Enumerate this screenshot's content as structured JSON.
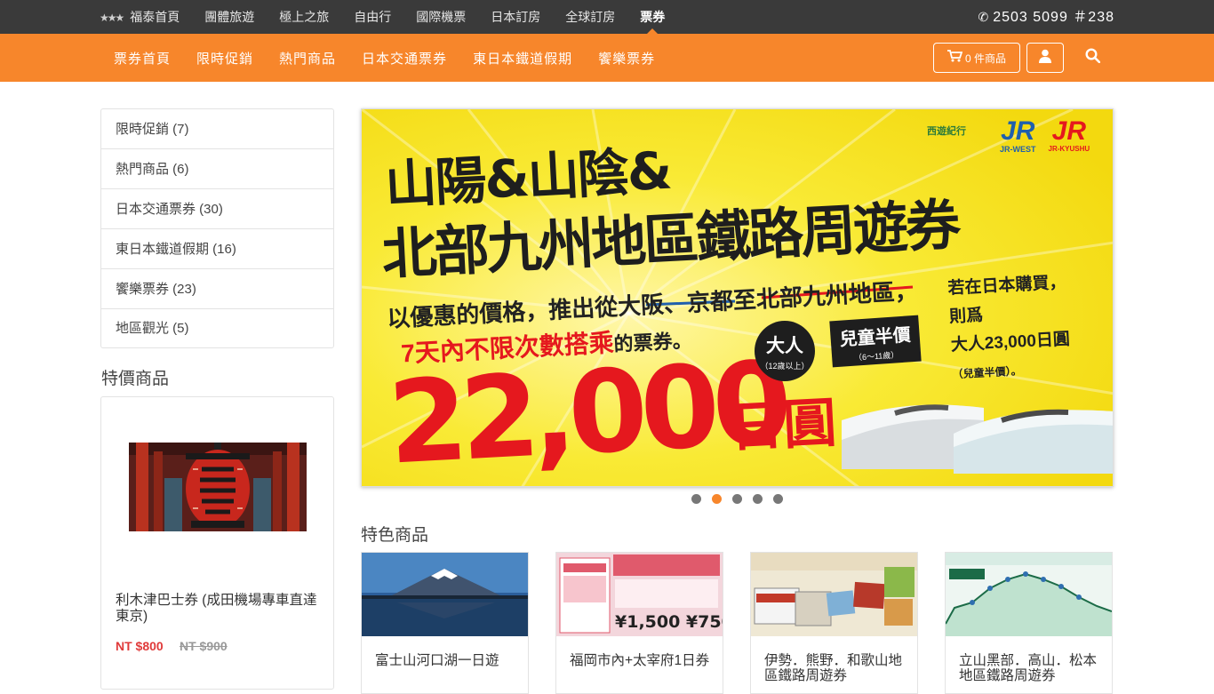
{
  "topbar": {
    "items": [
      {
        "label": "福泰首頁"
      },
      {
        "label": "團體旅遊"
      },
      {
        "label": "極上之旅"
      },
      {
        "label": "自由行"
      },
      {
        "label": "國際機票"
      },
      {
        "label": "日本訂房"
      },
      {
        "label": "全球訂房"
      },
      {
        "label": "票券",
        "active": true
      }
    ],
    "phone": "2503 5099 ＃238"
  },
  "subnav": {
    "items": [
      "票券首頁",
      "限時促銷",
      "熱門商品",
      "日本交通票券",
      "東日本鐵道假期",
      "饗樂票券"
    ],
    "cart_label": "0 件商品"
  },
  "sidebar": {
    "categories": [
      "限時促銷 (7)",
      "熱門商品 (6)",
      "日本交通票券 (30)",
      "東日本鐵道假期 (16)",
      "饗樂票券 (23)",
      "地區觀光 (5)"
    ],
    "special_title": "特價商品",
    "special_product": {
      "name": "利木津巴士券 (成田機場專車直達東京)",
      "price": "NT $800",
      "old_price": "NT $900"
    }
  },
  "banner": {
    "title_line1": "山陽&山陰&",
    "title_line2": "北部九州地區鐵路周遊券",
    "subtitle": "以優惠的價格，推出從大阪、京都至北部九州地區，",
    "highlight": "7天內不限次數搭乘",
    "highlight_suffix": "的票券。",
    "price": "22,000",
    "price_unit": "日圓",
    "adult_label": "大人",
    "adult_age": "（12歲以上）",
    "child_label": "兒童半價",
    "child_age": "（6～11歲）",
    "note_line1": "若在日本購買，",
    "note_line2": "則爲",
    "note_line3": "大人23,000日圓",
    "note_line4": "（兒童半價）。",
    "logo_saiyu": "西遊紀行",
    "logo_jrw_mark": "JR",
    "logo_jrw_text": "JR-WEST",
    "logo_jrk_mark": "JR",
    "logo_jrk_text": "JR-KYUSHU",
    "dots_count": 5,
    "active_dot": 1
  },
  "featured": {
    "title": "特色商品",
    "items": [
      {
        "name": "富士山河口湖一日遊"
      },
      {
        "name": "福岡市內+太宰府1日券"
      },
      {
        "name": "伊勢．熊野．和歌山地區鐵路周遊券"
      },
      {
        "name": "立山黑部．高山．松本地區鐵路周遊券"
      }
    ]
  },
  "colors": {
    "topbar_bg": "#3a3a3a",
    "accent_orange": "#f7862b",
    "price_red": "#e03a3a",
    "banner_yellow": "#f7e21c"
  }
}
